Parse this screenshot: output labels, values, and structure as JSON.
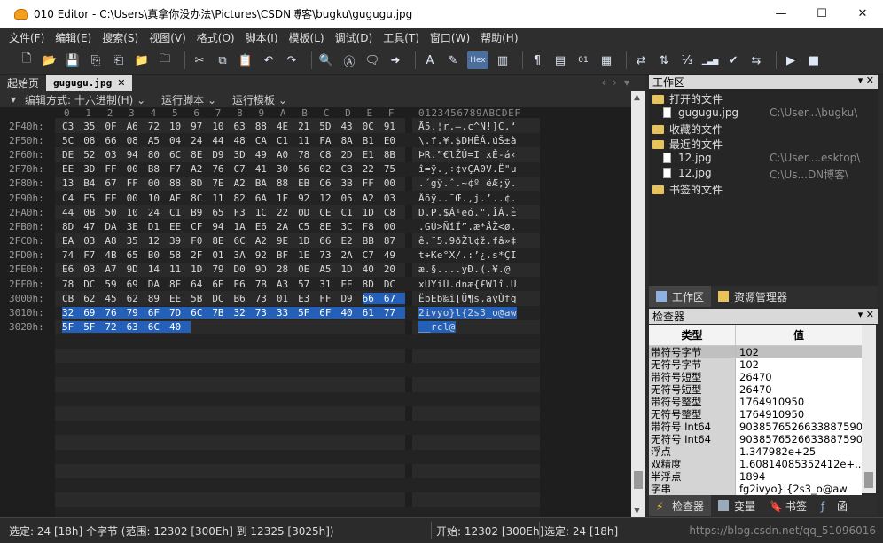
{
  "window": {
    "title": "010 Editor - C:\\Users\\真拿你没办法\\Pictures\\CSDN博客\\bugku\\gugugu.jpg",
    "minimize": "—",
    "maximize": "☐",
    "close": "✕"
  },
  "menu": [
    "文件(F)",
    "编辑(E)",
    "搜索(S)",
    "视图(V)",
    "格式(O)",
    "脚本(I)",
    "模板(L)",
    "调试(D)",
    "工具(T)",
    "窗口(W)",
    "帮助(H)"
  ],
  "toolbar": {
    "icons": [
      "new-file-icon",
      "open-icon",
      "save-icon",
      "save-as-icon",
      "save-all-icon",
      "open-folder-icon",
      "close-all-icon",
      "cut-icon",
      "copy-icon",
      "paste-icon",
      "undo-icon",
      "redo-icon",
      "find-icon",
      "replace-icon",
      "find-in-files-icon",
      "goto-icon",
      "font-icon",
      "highlight-icon",
      "hex-view-icon",
      "columns-icon",
      "paragraph-icon",
      "ruler-icon",
      "binary-icon",
      "templates-icon",
      "compare-icon",
      "swap-icon",
      "calculator-icon",
      "histogram-icon",
      "checksum-icon",
      "convert-icon",
      "run-icon",
      "stop-icon"
    ],
    "hex_label": "Hex"
  },
  "doc_tabs": {
    "start_page": "起始页",
    "file_tab": "gugugu.jpg",
    "close": "✕"
  },
  "subbar": {
    "edit_mode": "编辑方式: 十六进制(H) ⌄",
    "run_script": "运行脚本 ⌄",
    "run_template": "运行模板 ⌄"
  },
  "hex_view": {
    "column_headers": [
      "0",
      "1",
      "2",
      "3",
      "4",
      "5",
      "6",
      "7",
      "8",
      "9",
      "A",
      "B",
      "C",
      "D",
      "E",
      "F"
    ],
    "ascii_header": "0123456789ABCDEF",
    "rows": [
      {
        "offset": "2F40h:",
        "bytes": [
          "C3",
          "35",
          "0F",
          "A6",
          "72",
          "10",
          "97",
          "10",
          "63",
          "88",
          "4E",
          "21",
          "5D",
          "43",
          "0C",
          "91"
        ],
        "ascii": "Ã5.¦r.—.c^N!]C.‘",
        "hl_from": -1
      },
      {
        "offset": "2F50h:",
        "bytes": [
          "5C",
          "08",
          "66",
          "08",
          "A5",
          "04",
          "24",
          "44",
          "48",
          "CA",
          "C1",
          "11",
          "FA",
          "8A",
          "B1",
          "E0"
        ],
        "ascii": "\\.f.¥.$DHÊÁ.úŠ±à",
        "hl_from": -1
      },
      {
        "offset": "2F60h:",
        "bytes": [
          "DE",
          "52",
          "03",
          "94",
          "80",
          "6C",
          "8E",
          "D9",
          "3D",
          "49",
          "A0",
          "78",
          "C8",
          "2D",
          "E1",
          "8B"
        ],
        "ascii": "ÞR.”€lŽÙ=I xÈ-á‹",
        "hl_from": -1
      },
      {
        "offset": "2F70h:",
        "bytes": [
          "EE",
          "3D",
          "FF",
          "00",
          "B8",
          "F7",
          "A2",
          "76",
          "C7",
          "41",
          "30",
          "56",
          "02",
          "CB",
          "22",
          "75"
        ],
        "ascii": "î=ÿ.¸÷¢vÇA0V.Ë\"u",
        "hl_from": -1
      },
      {
        "offset": "2F80h:",
        "bytes": [
          "13",
          "B4",
          "67",
          "FF",
          "00",
          "88",
          "8D",
          "7E",
          "A2",
          "BA",
          "88",
          "EB",
          "C6",
          "3B",
          "FF",
          "00"
        ],
        "ascii": ".´gÿ.ˆ.~¢º ëÆ;ÿ.",
        "hl_from": -1
      },
      {
        "offset": "2F90h:",
        "bytes": [
          "C4",
          "F5",
          "FF",
          "00",
          "10",
          "AF",
          "8C",
          "11",
          "82",
          "6A",
          "1F",
          "92",
          "12",
          "05",
          "A2",
          "03"
        ],
        "ascii": "Äõÿ..¯Œ.‚j.’..¢.",
        "hl_from": -1
      },
      {
        "offset": "2FA0h:",
        "bytes": [
          "44",
          "0B",
          "50",
          "10",
          "24",
          "C1",
          "B9",
          "65",
          "F3",
          "1C",
          "22",
          "0D",
          "CE",
          "C1",
          "1D",
          "C8"
        ],
        "ascii": "D.P.$Á¹eó.\".ÎÁ.È",
        "hl_from": -1
      },
      {
        "offset": "2FB0h:",
        "bytes": [
          "8D",
          "47",
          "DA",
          "3E",
          "D1",
          "EE",
          "CF",
          "94",
          "1A",
          "E6",
          "2A",
          "C5",
          "8E",
          "3C",
          "F8",
          "00"
        ],
        "ascii": ".GÚ>ÑîÏ”.æ*ÅŽ<ø.",
        "hl_from": -1
      },
      {
        "offset": "2FC0h:",
        "bytes": [
          "EA",
          "03",
          "A8",
          "35",
          "12",
          "39",
          "F0",
          "8E",
          "6C",
          "A2",
          "9E",
          "1D",
          "66",
          "E2",
          "BB",
          "87"
        ],
        "ascii": "ê.¨5.9ðŽl¢ž.fâ»‡",
        "hl_from": -1
      },
      {
        "offset": "2FD0h:",
        "bytes": [
          "74",
          "F7",
          "4B",
          "65",
          "B0",
          "58",
          "2F",
          "01",
          "3A",
          "92",
          "BF",
          "1E",
          "73",
          "2A",
          "C7",
          "49"
        ],
        "ascii": "t÷Ke°X/.:’¿.s*ÇI",
        "hl_from": -1
      },
      {
        "offset": "2FE0h:",
        "bytes": [
          "E6",
          "03",
          "A7",
          "9D",
          "14",
          "11",
          "1D",
          "79",
          "D0",
          "9D",
          "28",
          "0E",
          "A5",
          "1D",
          "40",
          "20"
        ],
        "ascii": "æ.§....yÐ.(.¥.@ ",
        "hl_from": -1
      },
      {
        "offset": "2FF0h:",
        "bytes": [
          "78",
          "DC",
          "59",
          "69",
          "DA",
          "8F",
          "64",
          "6E",
          "E6",
          "7B",
          "A3",
          "57",
          "31",
          "EE",
          "8D",
          "DC"
        ],
        "ascii": "xÜYiÚ.dnæ{£W1î.Ü",
        "hl_from": -1
      },
      {
        "offset": "3000h:",
        "bytes": [
          "CB",
          "62",
          "45",
          "62",
          "89",
          "EE",
          "5B",
          "DC",
          "B6",
          "73",
          "01",
          "E3",
          "FF",
          "D9",
          "66",
          "67"
        ],
        "ascii": "ËbEb‰î[Ü¶s.ãÿÙfg",
        "hl_from": 14
      },
      {
        "offset": "3010h:",
        "bytes": [
          "32",
          "69",
          "76",
          "79",
          "6F",
          "7D",
          "6C",
          "7B",
          "32",
          "73",
          "33",
          "5F",
          "6F",
          "40",
          "61",
          "77"
        ],
        "ascii": "2ivyo}l{2s3_o@aw",
        "hl_from": 0
      },
      {
        "offset": "3020h:",
        "bytes": [
          "5F",
          "5F",
          "72",
          "63",
          "6C",
          "40",
          "",
          "",
          "",
          "",
          "",
          "",
          "",
          "",
          "",
          ""
        ],
        "ascii": "__rcl@",
        "hl_from": 0
      }
    ]
  },
  "workspace": {
    "header": "工作区",
    "pin": "▾",
    "close": "✕",
    "open_files_label": "打开的文件",
    "open_files": [
      {
        "name": "gugugu.jpg",
        "path": "C:\\User...\\bugku\\"
      }
    ],
    "favorites_label": "收藏的文件",
    "recent_label": "最近的文件",
    "recent_files": [
      {
        "name": "12.jpg",
        "path": "C:\\User....esktop\\"
      },
      {
        "name": "12.jpg",
        "path": "C:\\Us...DN博客\\"
      }
    ],
    "bookmarks_label": "书签的文件"
  },
  "panel_tabs_top": [
    "工作区",
    "资源管理器"
  ],
  "inspector": {
    "header": "检查器",
    "col_type": "类型",
    "col_value": "值",
    "rows": [
      {
        "k": "带符号字节",
        "v": "102",
        "sel": true
      },
      {
        "k": "无符号字节",
        "v": "102",
        "sel": false
      },
      {
        "k": "带符号短型",
        "v": "26470",
        "sel": false
      },
      {
        "k": "无符号短型",
        "v": "26470",
        "sel": false
      },
      {
        "k": "带符号整型",
        "v": "1764910950",
        "sel": false
      },
      {
        "k": "无符号整型",
        "v": "1764910950",
        "sel": false
      },
      {
        "k": "带符号 Int64",
        "v": "9038576526633887590",
        "sel": false
      },
      {
        "k": "无符号 Int64",
        "v": "9038576526633887590",
        "sel": false
      },
      {
        "k": "浮点",
        "v": "1.347982e+25",
        "sel": false
      },
      {
        "k": "双精度",
        "v": "1.60814085352412e+...",
        "sel": false
      },
      {
        "k": "半浮点",
        "v": "1894",
        "sel": false
      },
      {
        "k": "字串",
        "v": "fg2ivyo}l{2s3_o@aw",
        "sel": false
      }
    ]
  },
  "panel_tabs_bottom": [
    "检查器",
    "变量",
    "书签",
    "函"
  ],
  "status": {
    "selection": "选定: 24 [18h] 个字节 (范围: 12302 [300Eh] 到 12325 [3025h])",
    "start": "开始: 12302 [300Eh]",
    "selected": "选定: 24 [18h]",
    "watermark": "https://blog.csdn.net/qq_51096016"
  }
}
